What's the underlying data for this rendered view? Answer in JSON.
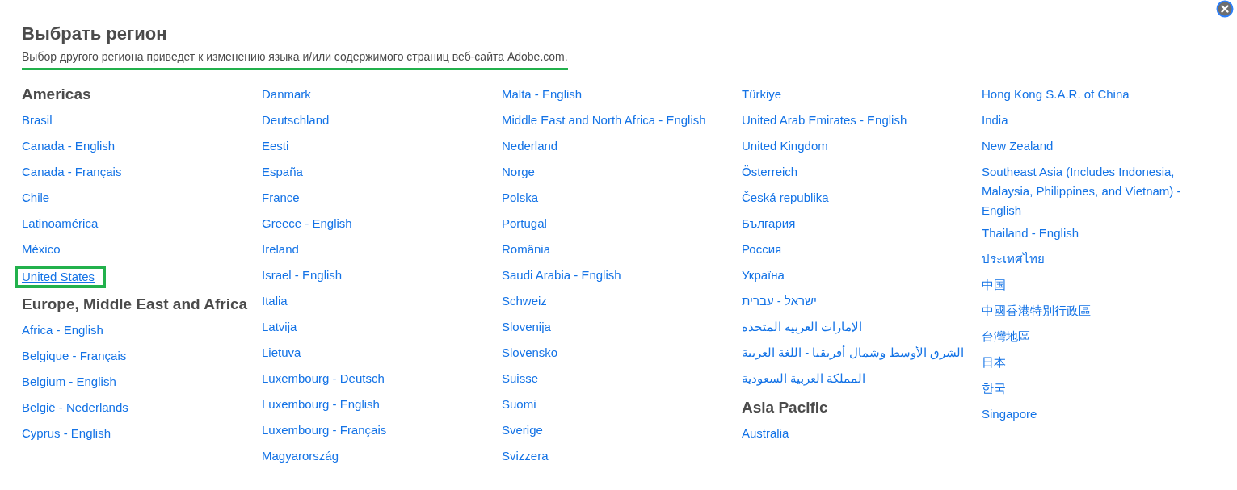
{
  "dialog": {
    "title": "Выбрать регион",
    "description": {
      "text": "Выбор другого региона приведет к изменению языка и/или содержимого страниц веб-сайта Adobe.com.",
      "highlighted": true
    }
  },
  "columns": [
    [
      {
        "kind": "heading",
        "text": "Americas"
      },
      {
        "kind": "link",
        "text": "Brasil",
        "highlighted": false
      },
      {
        "kind": "link",
        "text": "Canada - English",
        "highlighted": false
      },
      {
        "kind": "link",
        "text": "Canada - Français",
        "highlighted": false
      },
      {
        "kind": "link",
        "text": "Chile",
        "highlighted": false
      },
      {
        "kind": "link",
        "text": "Latinoamérica",
        "highlighted": false
      },
      {
        "kind": "link",
        "text": "México",
        "highlighted": false
      },
      {
        "kind": "link",
        "text": "United States",
        "highlighted": true
      },
      {
        "kind": "heading",
        "text": "Europe, Middle East and Africa"
      },
      {
        "kind": "link",
        "text": "Africa - English",
        "highlighted": false
      },
      {
        "kind": "link",
        "text": "Belgique - Français",
        "highlighted": false
      },
      {
        "kind": "link",
        "text": "Belgium - English",
        "highlighted": false
      },
      {
        "kind": "link",
        "text": "België - Nederlands",
        "highlighted": false
      },
      {
        "kind": "link",
        "text": "Cyprus - English",
        "highlighted": false
      }
    ],
    [
      {
        "kind": "link",
        "text": "Danmark",
        "highlighted": false
      },
      {
        "kind": "link",
        "text": "Deutschland",
        "highlighted": false
      },
      {
        "kind": "link",
        "text": "Eesti",
        "highlighted": false
      },
      {
        "kind": "link",
        "text": "España",
        "highlighted": false
      },
      {
        "kind": "link",
        "text": "France",
        "highlighted": false
      },
      {
        "kind": "link",
        "text": "Greece - English",
        "highlighted": false
      },
      {
        "kind": "link",
        "text": "Ireland",
        "highlighted": false
      },
      {
        "kind": "link",
        "text": "Israel - English",
        "highlighted": false
      },
      {
        "kind": "link",
        "text": "Italia",
        "highlighted": false
      },
      {
        "kind": "link",
        "text": "Latvija",
        "highlighted": false
      },
      {
        "kind": "link",
        "text": "Lietuva",
        "highlighted": false
      },
      {
        "kind": "link",
        "text": "Luxembourg - Deutsch",
        "highlighted": false
      },
      {
        "kind": "link",
        "text": "Luxembourg - English",
        "highlighted": false
      },
      {
        "kind": "link",
        "text": "Luxembourg - Français",
        "highlighted": false
      },
      {
        "kind": "link",
        "text": "Magyarország",
        "highlighted": false
      }
    ],
    [
      {
        "kind": "link",
        "text": "Malta - English",
        "highlighted": false
      },
      {
        "kind": "link",
        "text": "Middle East and North Africa - English",
        "highlighted": false
      },
      {
        "kind": "link",
        "text": "Nederland",
        "highlighted": false
      },
      {
        "kind": "link",
        "text": "Norge",
        "highlighted": false
      },
      {
        "kind": "link",
        "text": "Polska",
        "highlighted": false
      },
      {
        "kind": "link",
        "text": "Portugal",
        "highlighted": false
      },
      {
        "kind": "link",
        "text": "România",
        "highlighted": false
      },
      {
        "kind": "link",
        "text": "Saudi Arabia - English",
        "highlighted": false
      },
      {
        "kind": "link",
        "text": "Schweiz",
        "highlighted": false
      },
      {
        "kind": "link",
        "text": "Slovenija",
        "highlighted": false
      },
      {
        "kind": "link",
        "text": "Slovensko",
        "highlighted": false
      },
      {
        "kind": "link",
        "text": "Suisse",
        "highlighted": false
      },
      {
        "kind": "link",
        "text": "Suomi",
        "highlighted": false
      },
      {
        "kind": "link",
        "text": "Sverige",
        "highlighted": false
      },
      {
        "kind": "link",
        "text": "Svizzera",
        "highlighted": false
      }
    ],
    [
      {
        "kind": "link",
        "text": "Türkiye",
        "highlighted": false
      },
      {
        "kind": "link",
        "text": "United Arab Emirates - English",
        "highlighted": false
      },
      {
        "kind": "link",
        "text": "United Kingdom",
        "highlighted": false
      },
      {
        "kind": "link",
        "text": "Österreich",
        "highlighted": false
      },
      {
        "kind": "link",
        "text": "Česká republika",
        "highlighted": false
      },
      {
        "kind": "link",
        "text": "България",
        "highlighted": false
      },
      {
        "kind": "link",
        "text": "Россия",
        "highlighted": false
      },
      {
        "kind": "link",
        "text": "Україна",
        "highlighted": false
      },
      {
        "kind": "link",
        "text": "ישראל - עברית",
        "highlighted": false
      },
      {
        "kind": "link",
        "text": "الإمارات العربية المتحدة",
        "highlighted": false
      },
      {
        "kind": "link",
        "text": "الشرق الأوسط وشمال أفريقيا - اللغة العربية",
        "highlighted": false
      },
      {
        "kind": "link",
        "text": "المملكة العربية السعودية",
        "highlighted": false
      },
      {
        "kind": "heading",
        "text": "Asia Pacific"
      },
      {
        "kind": "link",
        "text": "Australia",
        "highlighted": false
      }
    ],
    [
      {
        "kind": "link",
        "text": "Hong Kong S.A.R. of China",
        "highlighted": false
      },
      {
        "kind": "link",
        "text": "India",
        "highlighted": false
      },
      {
        "kind": "link",
        "text": "New Zealand",
        "highlighted": false
      },
      {
        "kind": "link",
        "text": "Southeast Asia (Includes Indonesia, Malaysia, Philippines, and Vietnam) - English",
        "highlighted": false
      },
      {
        "kind": "link",
        "text": "Thailand - English",
        "highlighted": false
      },
      {
        "kind": "link",
        "text": "ประเทศไทย",
        "highlighted": false
      },
      {
        "kind": "link",
        "text": "中国",
        "highlighted": false
      },
      {
        "kind": "link",
        "text": "中國香港特別行政區",
        "highlighted": false
      },
      {
        "kind": "link",
        "text": "台灣地區",
        "highlighted": false
      },
      {
        "kind": "link",
        "text": "日本",
        "highlighted": false
      },
      {
        "kind": "link",
        "text": "한국",
        "highlighted": false
      },
      {
        "kind": "link",
        "text": "Singapore",
        "highlighted": false
      }
    ]
  ]
}
